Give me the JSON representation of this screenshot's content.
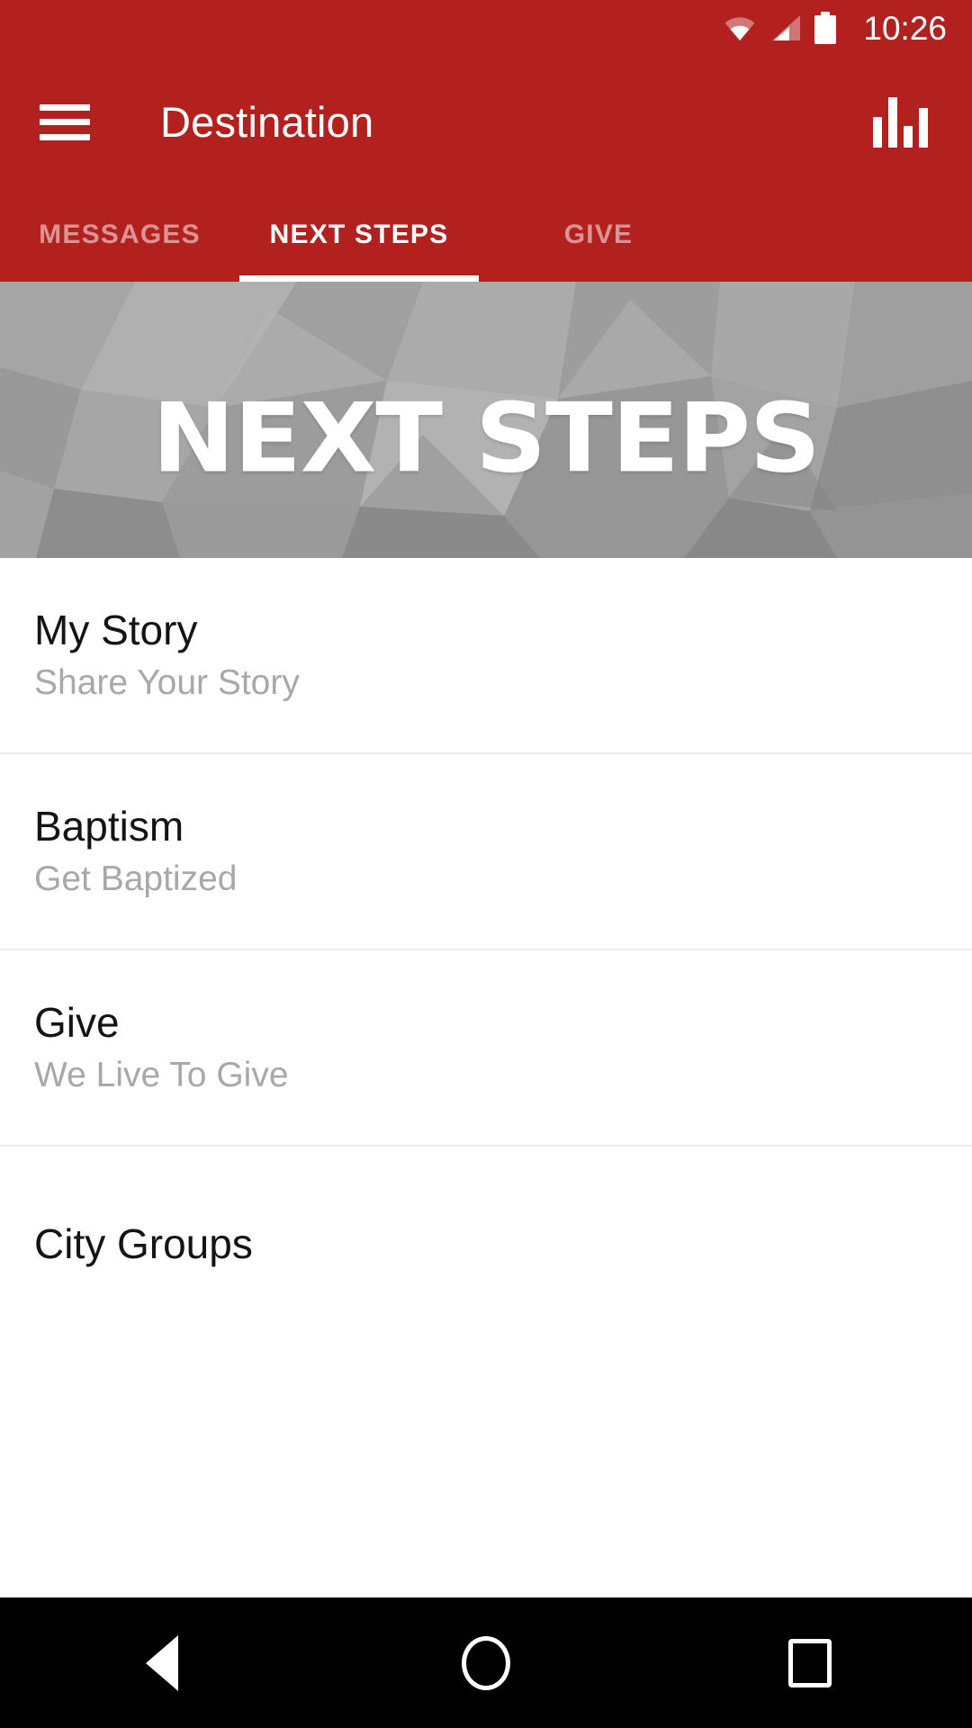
{
  "status_bar": {
    "time": "10:26",
    "icons": [
      "wifi-icon",
      "cellular-signal-icon",
      "battery-icon"
    ]
  },
  "app_bar": {
    "title": "Destination",
    "menu_icon": "hamburger-menu-icon",
    "action_icon": "bar-chart-icon"
  },
  "tabs": {
    "items": [
      {
        "label": "MESSAGES",
        "active": false
      },
      {
        "label": "NEXT STEPS",
        "active": true
      },
      {
        "label": "GIVE",
        "active": false
      }
    ]
  },
  "hero": {
    "title": "NEXT STEPS"
  },
  "list": {
    "items": [
      {
        "title": "My Story",
        "subtitle": "Share Your Story"
      },
      {
        "title": "Baptism",
        "subtitle": "Get Baptized"
      },
      {
        "title": "Give",
        "subtitle": "We Live To Give"
      },
      {
        "title": "City Groups",
        "subtitle": ""
      }
    ]
  },
  "nav_bar": {
    "back_label": "Back",
    "home_label": "Home",
    "recents_label": "Recent apps"
  },
  "colors": {
    "brand_red": "#b3211f",
    "hero_gray": "#9a9a9a",
    "title_text": "#141414",
    "subtitle_text": "#a8a8a8",
    "divider": "#ebebeb",
    "nav_bar": "#000000"
  }
}
